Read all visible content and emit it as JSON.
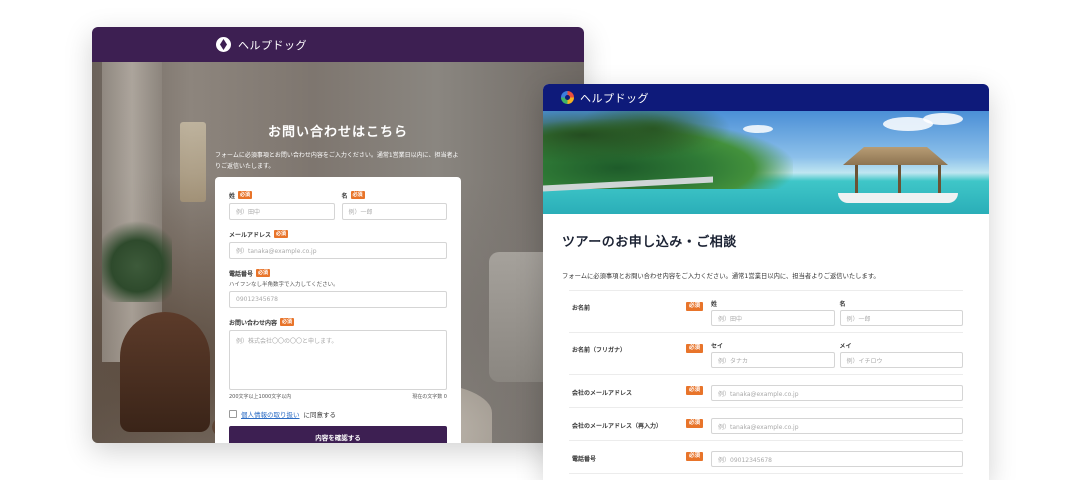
{
  "left_form": {
    "brand": "ヘルプドッグ",
    "title": "お問い合わせはこちら",
    "description": "フォームに必須事項とお問い合わせ内容をご入力ください。通常1営業日以内に、担当者よりご返信いたします。",
    "required_badge": "必須",
    "last_name": {
      "label": "姓",
      "placeholder": "例）田中"
    },
    "first_name": {
      "label": "名",
      "placeholder": "例）一郎"
    },
    "email": {
      "label": "メールアドレス",
      "placeholder": "例）tanaka@example.co.jp"
    },
    "phone": {
      "label": "電話番号",
      "hint": "ハイフンなし半角数字で入力してください。",
      "placeholder": "09012345678"
    },
    "inquiry": {
      "label": "お問い合わせ内容",
      "placeholder": "例）株式会社〇〇の〇〇と申します。",
      "limit_note": "200文字以上1000文字以内",
      "count_label": "現在の文字数 0"
    },
    "agree_link": "個人情報の取り扱い",
    "agree_suffix": "に同意する",
    "submit_label": "内容を確認する",
    "colors": {
      "header": "#3d1f52",
      "accent": "#e8742a"
    }
  },
  "right_form": {
    "brand": "ヘルプドッグ",
    "title": "ツアーのお申し込み・ご相談",
    "description": "フォームに必須事項とお問い合わせ内容をご入力ください。通常1営業日以内に、担当者よりご返信いたします。",
    "required_badge": "必須",
    "rows": {
      "name": {
        "label": "お名前",
        "sub1": "姓",
        "ph1": "例）田中",
        "sub2": "名",
        "ph2": "例）一郎"
      },
      "kana": {
        "label": "お名前（フリガナ）",
        "sub1": "セイ",
        "ph1": "例）タナカ",
        "sub2": "メイ",
        "ph2": "例）イチロウ"
      },
      "email": {
        "label": "会社のメールアドレス",
        "placeholder": "例）tanaka@example.co.jp"
      },
      "email_confirm": {
        "label": "会社のメールアドレス（再入力）",
        "placeholder": "例）tanaka@example.co.jp"
      },
      "phone": {
        "label": "電話番号",
        "placeholder": "例）09012345678"
      }
    },
    "colors": {
      "header": "#0e1a7a",
      "accent": "#e8742a"
    }
  }
}
